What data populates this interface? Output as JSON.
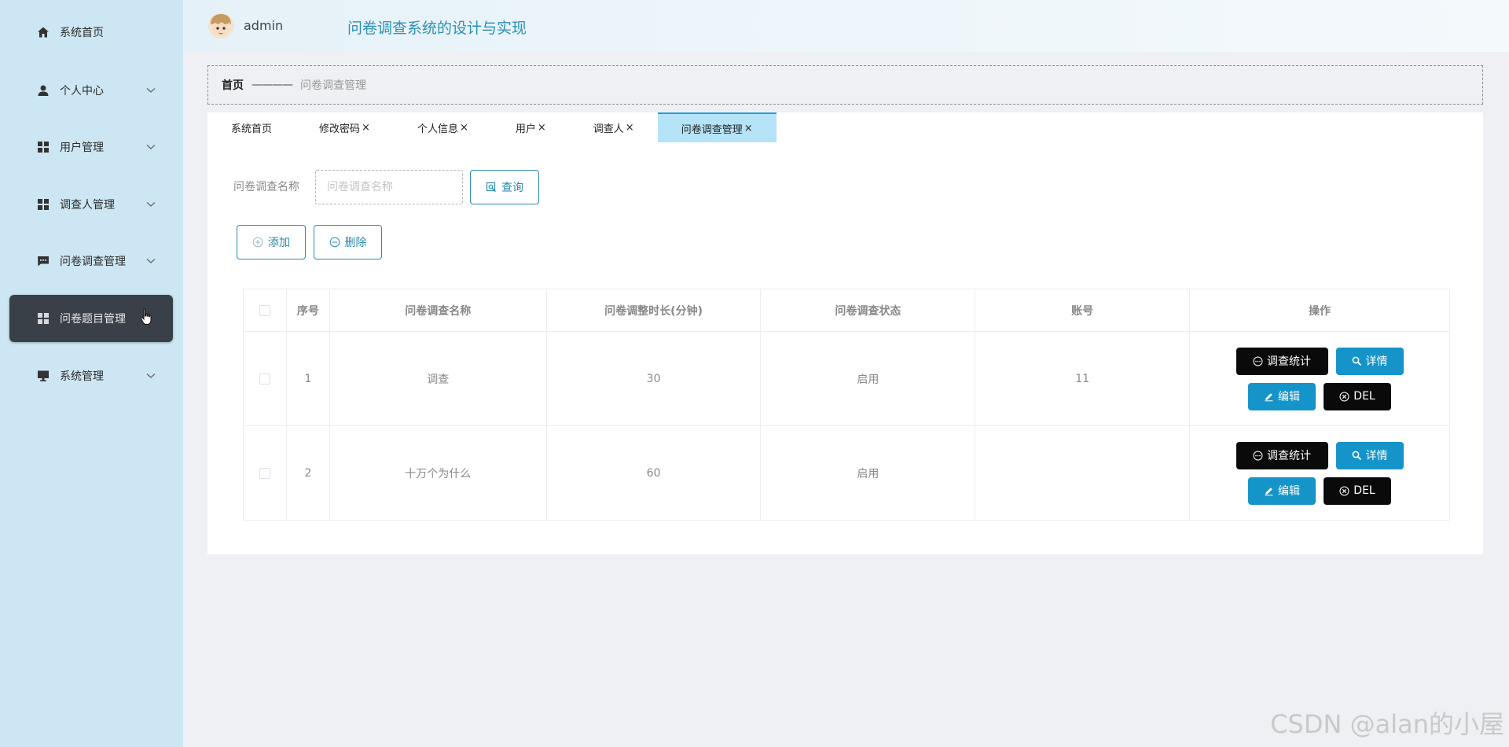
{
  "colors": {
    "sidebar_bg": "#cde6f3",
    "sidebar_active_bg": "#3a4048",
    "accent": "#2a8bad",
    "title_color": "#2a92b4",
    "tab_active_bg": "#b5e3f7",
    "op_dark": "#0a0a0a",
    "op_blue": "#1594c9"
  },
  "sidebar": {
    "items": [
      {
        "label": "系统首页",
        "icon": "home-icon"
      },
      {
        "label": "个人中心",
        "icon": "person-icon"
      },
      {
        "label": "用户管理",
        "icon": "grid-icon"
      },
      {
        "label": "调查人管理",
        "icon": "grid-icon"
      },
      {
        "label": "问卷调查管理",
        "icon": "message-icon"
      },
      {
        "label": "问卷题目管理",
        "icon": "grid-icon"
      },
      {
        "label": "系统管理",
        "icon": "monitor-icon"
      }
    ]
  },
  "header": {
    "username": "admin",
    "title": "问卷调查系统的设计与实现"
  },
  "breadcrumb": {
    "home": "首页",
    "separator": "————",
    "current": "问卷调查管理"
  },
  "tabs": [
    {
      "label": "系统首页",
      "close": ""
    },
    {
      "label": "修改密码",
      "close": "×"
    },
    {
      "label": "个人信息",
      "close": "×"
    },
    {
      "label": "用户",
      "close": "×"
    },
    {
      "label": "调查人",
      "close": "×"
    },
    {
      "label": "问卷调查管理",
      "close": "×"
    }
  ],
  "search": {
    "label": "问卷调查名称",
    "placeholder": "问卷调查名称",
    "button": "查询"
  },
  "actions": {
    "add": "添加",
    "delete": "删除"
  },
  "table": {
    "headers": [
      "序号",
      "问卷调查名称",
      "问卷调整时长(分钟)",
      "问卷调查状态",
      "账号",
      "操作"
    ],
    "rows": [
      {
        "index": "1",
        "name": "调查",
        "duration": "30",
        "status": "启用",
        "account": "11"
      },
      {
        "index": "2",
        "name": "十万个为什么",
        "duration": "60",
        "status": "启用",
        "account": ""
      }
    ],
    "ops": {
      "stat": "调查统计",
      "detail": "详情",
      "edit": "编辑",
      "del": "DEL"
    }
  },
  "watermark": "CSDN @alan的小屋"
}
